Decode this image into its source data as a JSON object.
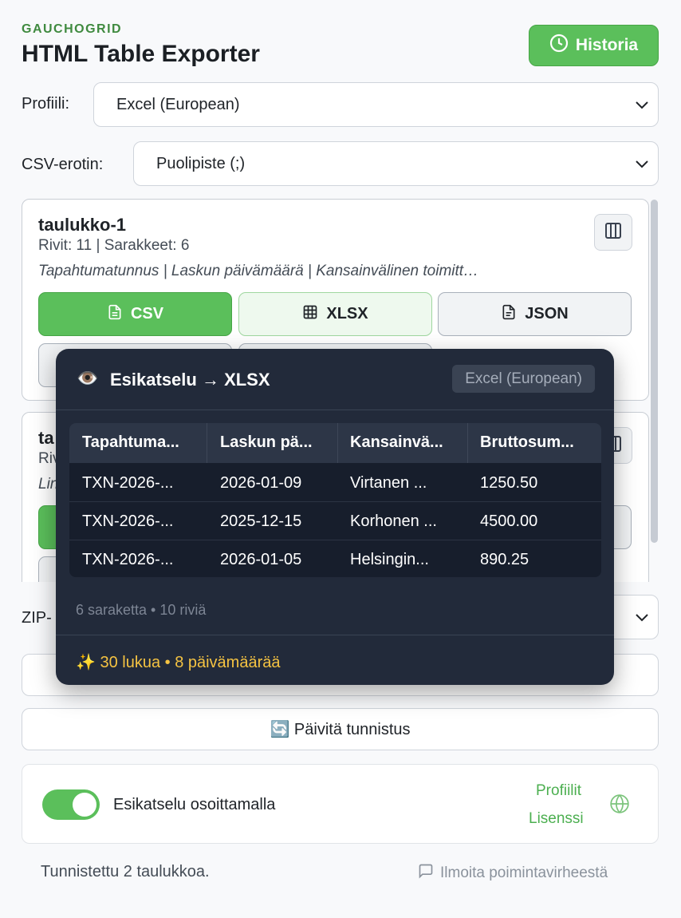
{
  "header": {
    "brand": "GAUCHOGRID",
    "title": "HTML Table Exporter",
    "history_label": "Historia"
  },
  "settings": {
    "profile_label": "Profiili:",
    "profile_value": "Excel (European)",
    "separator_label": "CSV-erotin:",
    "separator_value": "Puolipiste (;)",
    "zip_label": "ZIP-"
  },
  "tables": [
    {
      "name": "taulukko-1",
      "meta": "Rivit: 11 | Sarakkeet: 6",
      "columns": "Tapahtumatunnus | Laskun päivämäärä | Kansainvälinen toimitt…",
      "buttons": {
        "csv": "CSV",
        "xlsx": "XLSX",
        "json": "JSON"
      }
    },
    {
      "name": "ta",
      "meta": "Rivi",
      "columns": "Lin"
    }
  ],
  "actions": {
    "refresh_label": "🔄 Päivitä tunnistus"
  },
  "footer": {
    "hover_preview_label": "Esikatselu osoittamalla",
    "hover_preview_enabled": true,
    "profiles_link": "Profiilit",
    "license_link": "Lisenssi"
  },
  "status": {
    "detected": "Tunnistettu 2 taulukkoa.",
    "report_link": "Ilmoita poimintavirheestä"
  },
  "preview": {
    "eye": "👁️",
    "title": "Esikatselu → XLSX",
    "profile_badge": "Excel (European)",
    "headers": [
      "Tapahtuma...",
      "Laskun pä...",
      "Kansainvä...",
      "Bruttosum..."
    ],
    "rows": [
      [
        "TXN-2026-...",
        "2026-01-09",
        "Virtanen ...",
        "1250.50"
      ],
      [
        "TXN-2026-...",
        "2025-12-15",
        "Korhonen ...",
        "4500.00"
      ],
      [
        "TXN-2026-...",
        "2026-01-05",
        "Helsingin...",
        "890.25"
      ]
    ],
    "info": "6 saraketta • 10 riviä",
    "stats": "✨ 30 lukua • 8 päivämäärää"
  },
  "colors": {
    "accent_green": "#5bbf5b",
    "popup_bg": "#222a3a",
    "stats_yellow": "#f5c342"
  }
}
